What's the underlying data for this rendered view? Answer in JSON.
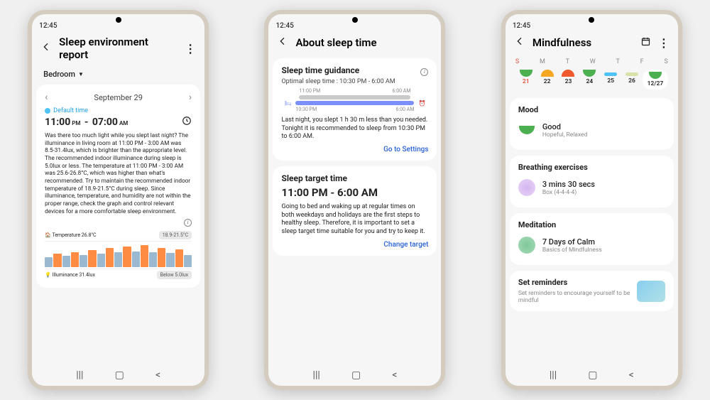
{
  "status_time": "12:45",
  "phone1": {
    "title": "Sleep environment report",
    "room": "Bedroom",
    "date": "September 29",
    "default_label": "Default time",
    "start_time": "11:00",
    "start_ampm": "PM",
    "end_time": "07:00",
    "end_ampm": "AM",
    "description": "Was there too much light while you slept last night? The illuminance in living room at 11:00 PM - 3:00 AM was 8.5-31.4lux, which is brighter than the appropriate level. The recommended indoor illuminance during sleep is 5.0lux or less. The temperature at 11:00 PM - 3:00 AM was 25.6-26.8°C, which was higher than what's recommended. Try to maintain the recommended indoor temperature of 18.9-21.5°C during sleep. Since illuminance, temperature, and humidity are not within the proper range, check the graph and control relevant devices for a more comfortable sleep environment.",
    "temp_label": "Temperature 26.8°C",
    "temp_range": "18.9-21.5°C",
    "lux_label": "Illuminance 31.4lux",
    "lux_range": "Below 5.0lux"
  },
  "phone2": {
    "title": "About sleep time",
    "sec1_title": "Sleep time guidance",
    "optimal": "Optimal sleep time : 10:30 PM - 6:00 AM",
    "t1": "11:00 PM",
    "t2": "6:00 AM",
    "t3": "10:30 PM",
    "t4": "6:00 AM",
    "desc1": "Last night, you slept 1 h 30 m less than you needed. Tonight it is recommended to sleep from 10:30 PM to 6:00 AM.",
    "link1": "Go to Settings",
    "sec2_title": "Sleep target time",
    "target_time": "11:00 PM - 6:00 AM",
    "desc2": "Going to bed and waking up at regular times on both weekdays and holidays are the first steps to healthy sleep. Therefore, it is important to set a sleep target time suitable for you and try to keep it.",
    "link2": "Change target"
  },
  "phone3": {
    "title": "Mindfulness",
    "days": [
      "S",
      "M",
      "T",
      "W",
      "T",
      "F",
      "S"
    ],
    "dates": [
      "21",
      "22",
      "23",
      "24",
      "25",
      "26",
      "12/27"
    ],
    "mood_title": "Mood",
    "mood_value": "Good",
    "mood_sub": "Hopeful, Relaxed",
    "breath_title": "Breathing exercises",
    "breath_value": "3 mins 30 secs",
    "breath_sub": "Box (4-4-4-4)",
    "med_title": "Meditation",
    "med_value": "7 Days of Calm",
    "med_sub": "Basics of Mindfulness",
    "reminder_title": "Set reminders",
    "reminder_sub": "Set reminders to encourage yourself to be mindful"
  }
}
